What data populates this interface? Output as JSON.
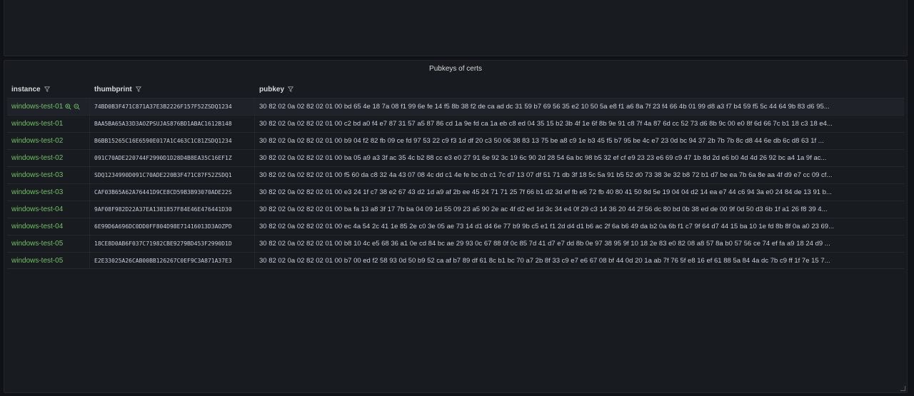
{
  "panel": {
    "title": "Pubkeys of certs"
  },
  "columns": {
    "instance": "instance",
    "thumbprint": "thumbprint",
    "pubkey": "pubkey"
  },
  "rows": [
    {
      "instance": "windows-test-01",
      "thumbprint": "74BD0B3F471C871A37E3B2226F157F52ZSDQ1234",
      "pubkey": "30 82 02 0a 02 82 02 01 00 bd 65 4e 18 7a 08 f1 99 6e fe 14 f5 8b 38 f2 de ca ad dc 31 59 b7 69 56 35 e2 10 50 5a e8 f1 a6 8a 7f 23 f4 66 4b 01 99 d8 a3 f7 b4 59 f5 5c 44 64 9b 83 d6 95..."
    },
    {
      "instance": "windows-test-01",
      "thumbprint": "BAA5BA65A33D3AOZPSUJAS876BD1ABAC1612B148",
      "pubkey": "30 82 02 0a 02 82 02 01 00 c2 bd a0 f4 e7 87 31 57 a5 87 86 cd 1a 9e fd ca 1a eb c8 ed 04 35 15 b2 3b 4f 1e 6f 8b 9e 91 c8 7f 4a 87 6d cc 52 73 d6 8b 9c 00 e0 8f 6d 66 7c b1 18 c3 18 e4..."
    },
    {
      "instance": "windows-test-02",
      "thumbprint": "B6BB15265C16E6590E017A1C463C1C81ZSDQ1234",
      "pubkey": "30 82 02 0a 02 82 02 01 00 b9 04 f2 82 fb 09 ce fd 97 53 22 c9 f3 1d df 20 c3 50 06 38 83 13 75 be a8 c9 1e b3 45 f5 b7 95 be 4c e7 23 0d bc 94 37 2b 7b 7b 8c d8 44 6e db 6c d8 63 1f ..."
    },
    {
      "instance": "windows-test-02",
      "thumbprint": "091C70ADE220744F2990D1D28D4B8EA35C16EF1Z",
      "pubkey": "30 82 02 0a 02 82 02 01 00 ba 05 a9 a3 3f ac 35 4c b2 88 cc e3 e0 27 91 6e 92 3c 19 6c 90 2d 28 54 6a bc 98 b5 32 ef cf e9 23 23 e6 69 c9 47 1b 8d 2d e6 b0 4d 4d 26 92 bc a4 1a 9f ac..."
    },
    {
      "instance": "windows-test-03",
      "thumbprint": "SDQ1234990D091C70ADE220B3F471C87F52ZSDQ1",
      "pubkey": "30 82 02 0a 02 82 02 01 00 f5 60 da c8 32 4a 43 07 08 4c dd c1 4e fe bc cb c1 7c d7 13 07 df 51 71 db 3f 18 5c 5a 91 b5 52 d0 73 38 3e 32 b8 72 b1 d7 be ea 7b 6a 8e aa 4f d9 e7 cc 09 cf..."
    },
    {
      "instance": "windows-test-03",
      "thumbprint": "CAF03B65A62A76441D9CE8CD59B3B93070ADE22S",
      "pubkey": "30 82 02 0a 02 82 02 01 00 e3 24 1f c7 38 e2 67 43 d2 1d a9 af 2b ee 45 24 71 71 25 7f 66 b1 d2 3d ef fb e6 72 fb 40 80 41 50 8d 5e 19 04 04 d2 14 ea e7 44 c6 94 3a e0 24 84 de 13 91 b..."
    },
    {
      "instance": "windows-test-04",
      "thumbprint": "9AF08F982D22A37EA1381857F84E46E476441D30",
      "pubkey": "30 82 02 0a 02 82 02 01 00 ba fa 13 a8 3f 17 7b ba 04 09 1d 55 09 23 a5 90 2e ac 4f d2 ed 1d 3c 34 e4 0f 29 c3 14 36 20 44 2f 56 dc 80 bd 0b 38 ed de 00 9f 0d 50 d3 6b 1f a1 26 f8 39 4..."
    },
    {
      "instance": "windows-test-04",
      "thumbprint": "6E99D6A696DC0DD0FF804D98E71416013D3AOZPD",
      "pubkey": "30 82 02 0a 02 82 02 01 00 ec 4a 54 2c 41 1e 85 2e c0 3e 05 ae 73 14 d1 d4 6e 77 b9 9b c5 e1 f1 2d d4 d1 b6 ac 2f 6a b6 49 da b2 0a 6b f1 c7 9f 64 d7 44 15 ba 10 1e fd 8b 8f 0a a0 23 69..."
    },
    {
      "instance": "windows-test-05",
      "thumbprint": "18CE8D0AB6F037C71982CBE9279BD453F2990D1D",
      "pubkey": "30 82 02 0a 02 82 02 01 00 b8 10 4c e5 68 36 a1 0e cd 84 bc ae 29 93 0c 67 88 0f 0c 85 7d 41 d7 e7 dd 8b 0e 97 38 95 9f 10 18 2e 83 e0 82 08 a8 57 8a b0 57 56 ce 74 ef fa a9 18 24 d9 ..."
    },
    {
      "instance": "windows-test-05",
      "thumbprint": "E2E33025A26CAB00BB126267C0EF9C3A871A37E3",
      "pubkey": "30 82 02 0a 02 82 02 01 00 b7 00 ed f2 58 93 0d 50 b9 52 ca af b7 89 df 61 8c b1 bc 70 a7 2b 8f 33 c9 e7 e6 67 08 bf 44 0d 20 1a ab 7f 76 5f e8 16 ef 61 88 5a 84 4a dc 7b c9 ff 1f 7e 15 7..."
    }
  ],
  "colors": {
    "background": "#111217",
    "panel": "#181b1f",
    "instance_text": "#73bf69",
    "text": "#ccccdc"
  },
  "icons": {
    "filter": "filter-icon",
    "zoom_in": "zoom-in-icon",
    "zoom_out": "zoom-out-icon"
  }
}
